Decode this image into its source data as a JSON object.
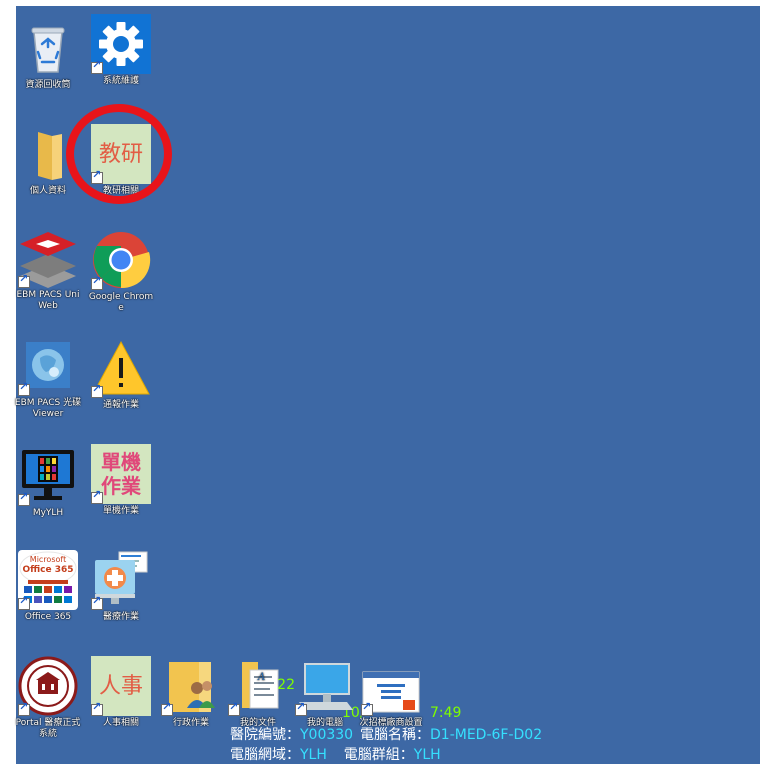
{
  "desktop": {
    "icons": [
      {
        "label": "資源回收筒",
        "icon": "recycle-bin-icon"
      },
      {
        "label": "系統維護",
        "icon": "gear-icon"
      },
      {
        "label": "個人資料",
        "icon": "folder-icon"
      },
      {
        "label": "教研相關",
        "icon": "tile-icon",
        "tile_text": "教研",
        "tile_color": "#d3e6c0",
        "text_color": "#e25d45"
      },
      {
        "label": "EBM PACS UniWeb",
        "icon": "layers-icon"
      },
      {
        "label": "Google Chrome",
        "icon": "chrome-icon"
      },
      {
        "label": "EBM PACS 光碟 Viewer",
        "icon": "viewer-icon"
      },
      {
        "label": "通報作業",
        "icon": "warning-icon"
      },
      {
        "label": "MyYLH",
        "icon": "monitor-grid-icon"
      },
      {
        "label": "單機作業",
        "icon": "tile-icon",
        "tile_text": "單機作業",
        "tile_color": "#d3e6c0",
        "text_color": "#e0487a"
      },
      {
        "label": "Office 365",
        "icon": "office365-icon",
        "badge": "Microsoft",
        "product": "Office 365"
      },
      {
        "label": "醫療作業",
        "icon": "medical-icon"
      },
      {
        "label": "Portal 醫療正式系統",
        "icon": "hospital-seal-icon"
      },
      {
        "label": "人事相關",
        "icon": "tile-icon",
        "tile_text": "人事",
        "tile_color": "#d3e6c0",
        "text_color": "#e25d45"
      },
      {
        "label": "行政作業",
        "icon": "people-folder-icon"
      },
      {
        "label": "我的文件",
        "icon": "documents-icon"
      },
      {
        "label": "我的電腦",
        "icon": "computer-icon"
      },
      {
        "label": "次招標廠商設置",
        "icon": "screenshot-icon"
      }
    ]
  },
  "bginfo": {
    "ip_fragment": "172.22",
    "date_fragment": "10/",
    "time_fragment": "7:49",
    "asset_label": "醫院編號：",
    "asset_value": "Y00330",
    "name_label": "電腦名稱：",
    "name_value": "D1-MED-6F-D02",
    "domain_label": "電腦網域：",
    "domain_value": "YLH",
    "group_label": "電腦群組：",
    "group_value": "YLH"
  },
  "annotation": {
    "color": "#e8141a",
    "target": "教研相關"
  }
}
